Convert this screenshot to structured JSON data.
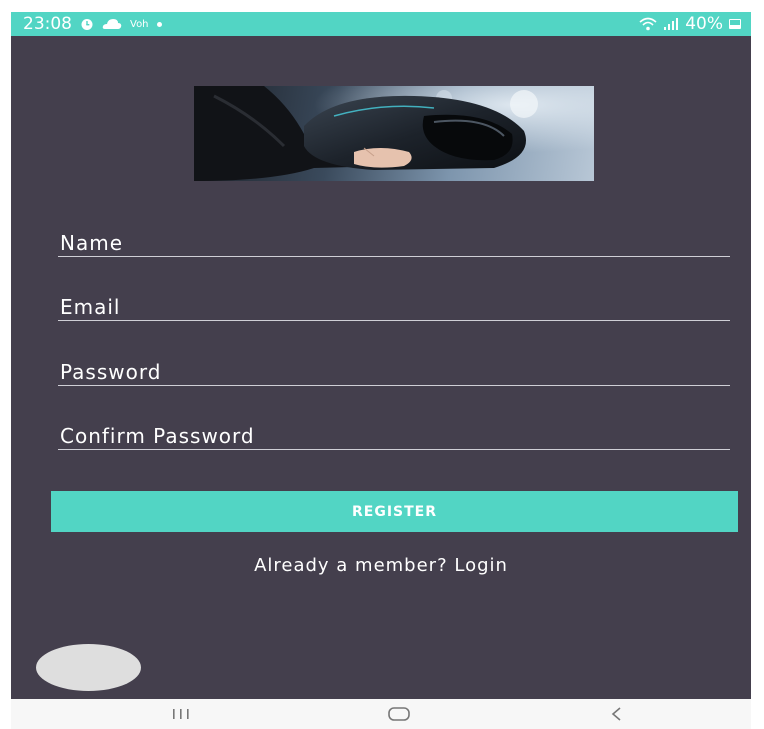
{
  "status_bar": {
    "time": "23:08",
    "network_label": "Voh",
    "battery_percent": "40%",
    "icons": [
      "alarm-icon",
      "cloud-icon",
      "notification-dot-icon",
      "wifi-icon",
      "signal-icon",
      "battery-icon"
    ]
  },
  "form": {
    "name_placeholder": "Name",
    "email_placeholder": "Email",
    "password_placeholder": "Password",
    "confirm_password_placeholder": "Confirm Password",
    "register_label": "REGISTER",
    "login_link": "Already a member? Login"
  },
  "nav_bar": {
    "icons": [
      "recent-apps-icon",
      "home-icon",
      "back-icon"
    ]
  },
  "colors": {
    "accent": "#52d5c4",
    "background": "#443f4d",
    "text": "#ffffff",
    "fab": "#dedede",
    "nav_bar": "#f7f7f7"
  }
}
